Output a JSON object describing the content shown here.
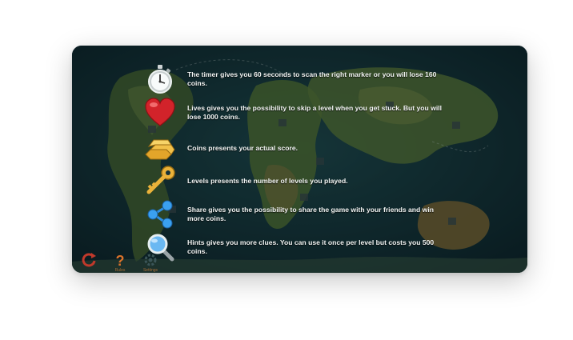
{
  "tutorial": {
    "items": [
      {
        "icon": "stopwatch-icon",
        "text": "The timer gives you 60 seconds to scan the right marker or you will lose 160 coins."
      },
      {
        "icon": "heart-icon",
        "text": "Lives gives you the possibility to skip a level when you get stuck. But you will lose 1000 coins."
      },
      {
        "icon": "gold-bars-icon",
        "text": "Coins presents your actual score."
      },
      {
        "icon": "key-icon",
        "text": "Levels presents the number of levels you played."
      },
      {
        "icon": "share-icon",
        "text": "Share gives you the possibility to share the game with your friends and win more coins."
      },
      {
        "icon": "magnifier-icon",
        "text": "Hints gives you more clues. You can use it once per level but costs you 500 coins."
      }
    ]
  },
  "bottom_bar": {
    "buttons": [
      {
        "icon": "restart-icon",
        "label": ""
      },
      {
        "icon": "help-icon",
        "label": "Rules"
      },
      {
        "icon": "settings-icon",
        "label": "Settings"
      }
    ]
  },
  "colors": {
    "text": "#f2f4f3",
    "ocean": "#14323a",
    "land": "#5f7a3a",
    "accent": "#c8402a"
  }
}
